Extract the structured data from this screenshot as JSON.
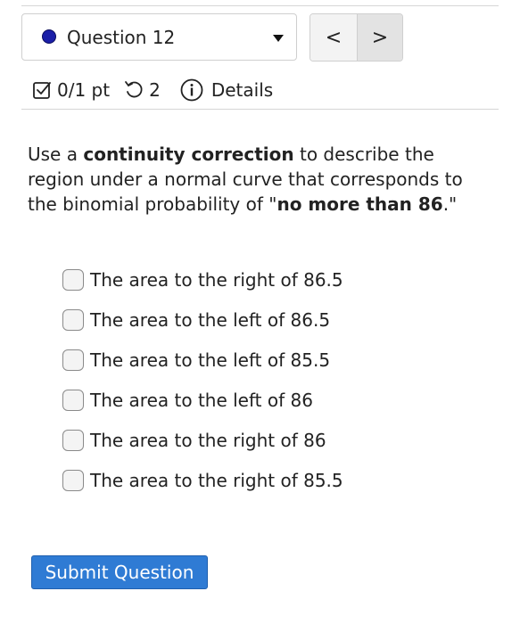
{
  "header": {
    "question_label": "Question 12",
    "status_icon": "filled-circle",
    "status_color": "#1b1fa8",
    "prev_label": "<",
    "next_label": ">"
  },
  "meta": {
    "score": "0/1 pt",
    "attempts": "2",
    "details_label": "Details",
    "score_icon": "checkbox-check-icon",
    "attempts_icon": "retry-icon",
    "details_icon": "info-icon"
  },
  "question": {
    "prompt_before": "Use a ",
    "prompt_bold_1": "continuity correction",
    "prompt_middle": " to describe the region under a normal curve that corresponds to the binomial probability of \"",
    "prompt_bold_2": "no more than 86",
    "prompt_after": ".\""
  },
  "options": [
    {
      "label": "The area to the right of 86.5",
      "checked": false
    },
    {
      "label": "The area to the left of 86.5",
      "checked": false
    },
    {
      "label": "The area to the left of 85.5",
      "checked": false
    },
    {
      "label": "The area to the left of 86",
      "checked": false
    },
    {
      "label": "The area to the right of 86",
      "checked": false
    },
    {
      "label": "The area to the right of 85.5",
      "checked": false
    }
  ],
  "submit_label": "Submit Question",
  "colors": {
    "accent": "#2f7bd4",
    "border": "#cfcfcf"
  }
}
